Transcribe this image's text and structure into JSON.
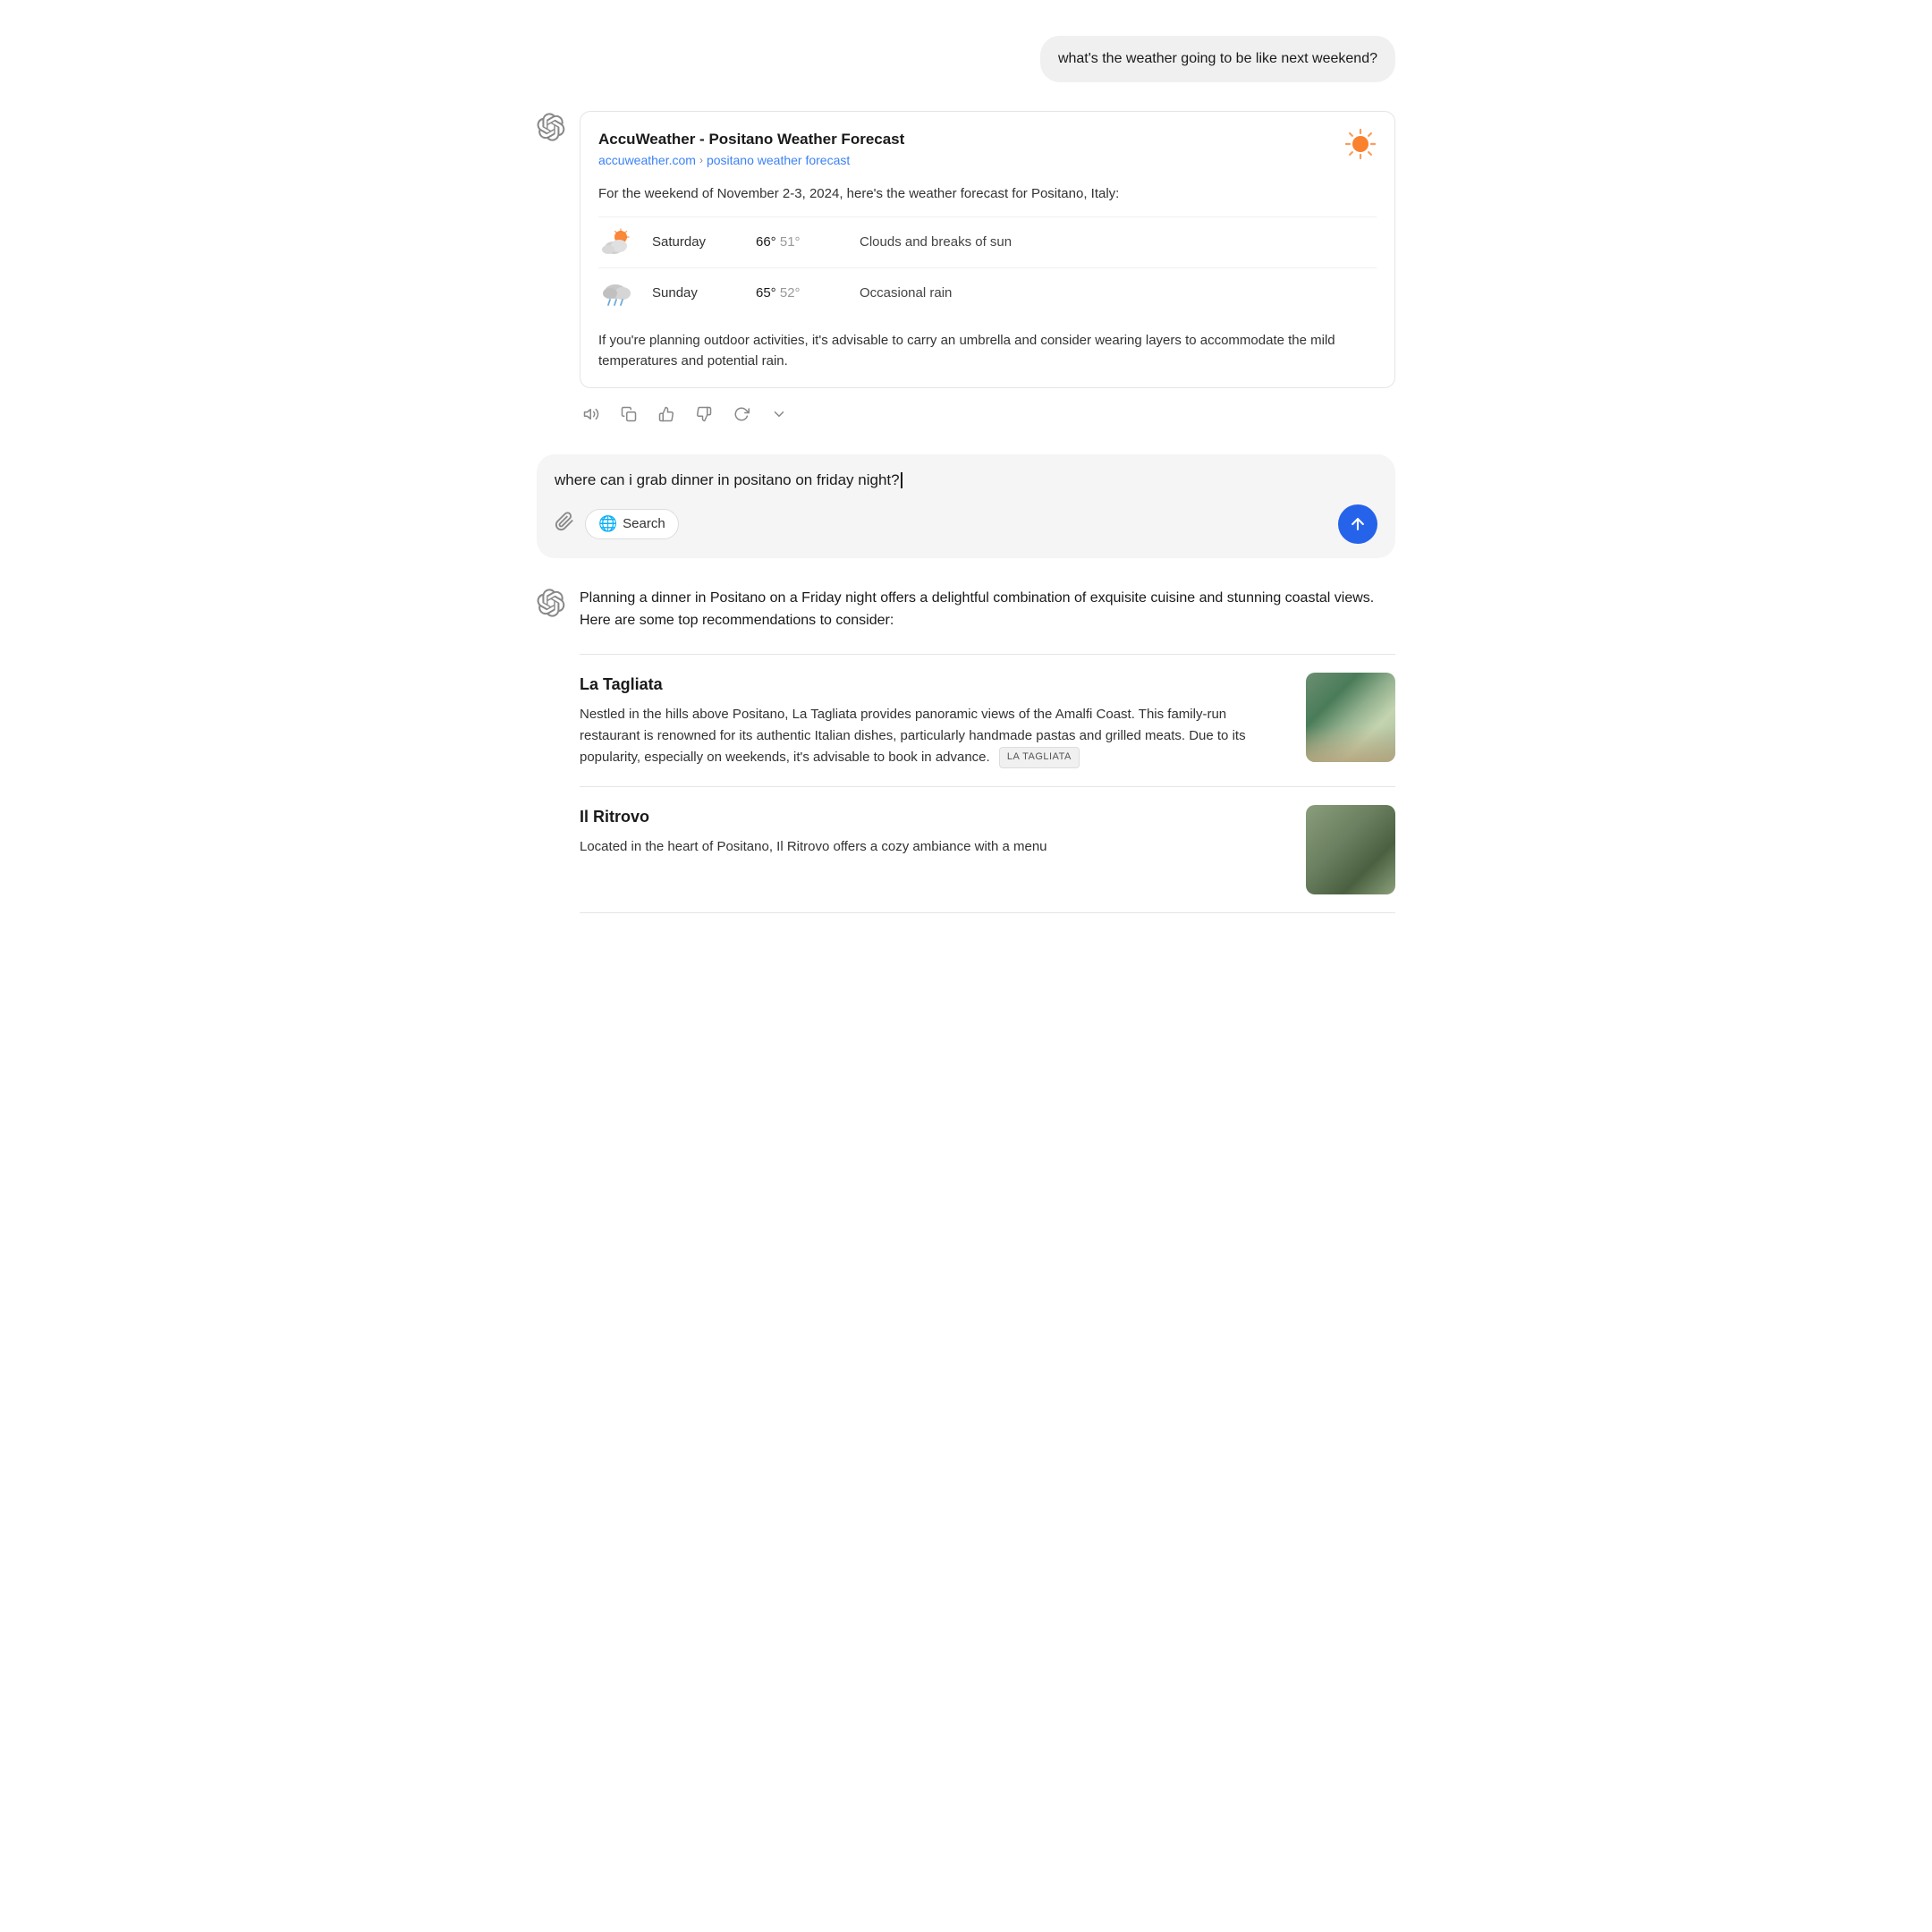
{
  "user_messages": {
    "first": "what's the weather going to be like next weekend?",
    "second": "where can i grab dinner in positano on friday night?"
  },
  "weather_result": {
    "title": "AccuWeather - Positano Weather Forecast",
    "site_name": "accuweather.com",
    "breadcrumb_separator": "›",
    "breadcrumb_path": "positano weather forecast",
    "intro": "For the weekend of November 2-3, 2024, here's the weather forecast for Positano, Italy:",
    "days": [
      {
        "name": "Saturday",
        "high": "66°",
        "low": "51°",
        "description": "Clouds and breaks of sun"
      },
      {
        "name": "Sunday",
        "high": "65°",
        "low": "52°",
        "description": "Occasional rain"
      }
    ],
    "advice": "If you're planning outdoor activities, it's advisable to carry an umbrella and consider wearing layers to accommodate the mild temperatures and potential rain."
  },
  "input": {
    "text": "where can i grab dinner in positano on friday night?",
    "attach_label": "Attach",
    "search_label": "Search",
    "send_label": "Send"
  },
  "dinner_response": {
    "intro": "Planning a dinner in Positano on a Friday night offers a delightful combination of exquisite cuisine and stunning coastal views. Here are some top recommendations to consider:",
    "restaurants": [
      {
        "name": "La Tagliata",
        "tag": "LA TAGLIATA",
        "description": "Nestled in the hills above Positano, La Tagliata provides panoramic views of the Amalfi Coast. This family-run restaurant is renowned for its authentic Italian dishes, particularly handmade pastas and grilled meats. Due to its popularity, especially on weekends, it's advisable to book in advance."
      },
      {
        "name": "Il Ritrovo",
        "tag": null,
        "description": "Located in the heart of Positano, Il Ritrovo offers a cozy ambiance with a menu"
      }
    ]
  },
  "action_buttons": {
    "speaker": "🔊",
    "copy": "⎘",
    "thumbsup": "👍",
    "thumbsdown": "👎",
    "refresh": "↻",
    "more": "▾"
  }
}
